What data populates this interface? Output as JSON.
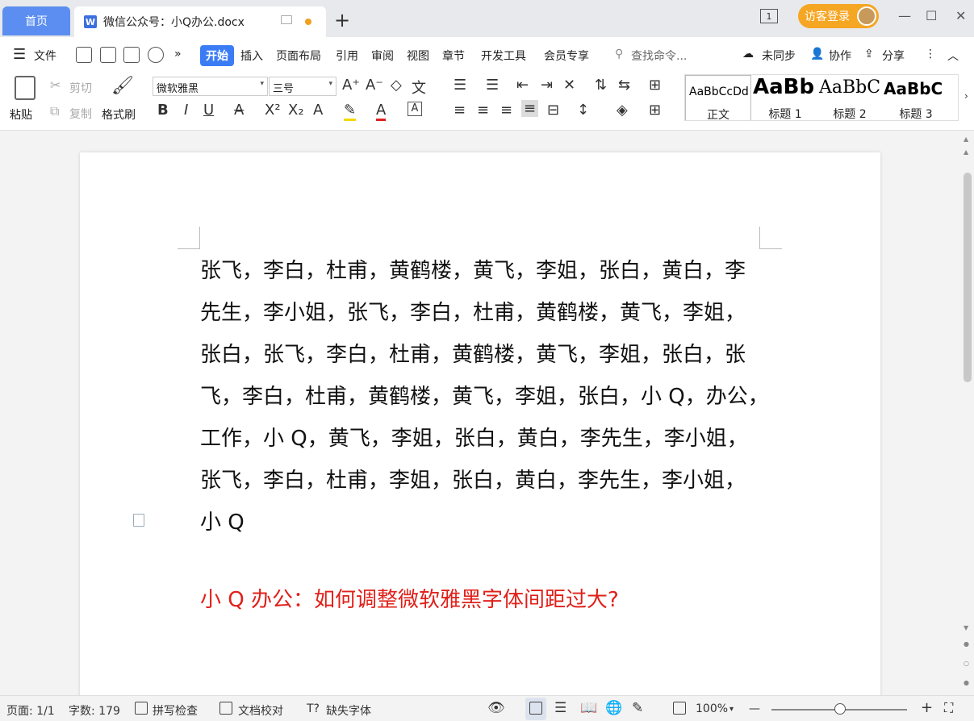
{
  "titlebar": {
    "home_tab": "首页",
    "doc_tab": "微信公众号：小Q办公.docx",
    "doc_icon": "W",
    "new_tab": "+",
    "window_count": "1",
    "guest_login": "访客登录",
    "minimize": "—",
    "maximize": "☐",
    "close": "✕"
  },
  "menubar": {
    "file": "文件",
    "more": "»",
    "tabs": [
      "开始",
      "插入",
      "页面布局",
      "引用",
      "审阅",
      "视图",
      "章节",
      "开发工具",
      "会员专享"
    ],
    "search": "查找命令...",
    "sync": "未同步",
    "collab": "协作",
    "share": "分享",
    "menu": "⋮",
    "collapse": "︿"
  },
  "ribbon": {
    "paste": "粘贴",
    "cut": "剪切",
    "copy": "复制",
    "format_painter": "格式刷",
    "font_name": "微软雅黑",
    "font_size": "三号",
    "styles": [
      {
        "sample": "AaBbCcDd",
        "name": "正文"
      },
      {
        "sample": "AaBb",
        "name": "标题 1"
      },
      {
        "sample": "AaBbC",
        "name": "标题 2"
      },
      {
        "sample": "AaBbC",
        "name": "标题 3"
      }
    ]
  },
  "document": {
    "lines": [
      "张飞，李白，杜甫，黄鹤楼，黄飞，李姐，张白，黄白，李",
      "先生，李小姐，张飞，李白，杜甫，黄鹤楼，黄飞，李姐，",
      "张白，张飞，李白，杜甫，黄鹤楼，黄飞，李姐，张白，张",
      "飞，李白，杜甫，黄鹤楼，黄飞，李姐，张白，小 Q，办公，",
      "工作，小 Q，黄飞，李姐，张白，黄白，李先生，李小姐，",
      "张飞，李白，杜甫，李姐，张白，黄白，李先生，李小姐，",
      "小 Q"
    ],
    "red_line": "小 Q 办公：如何调整微软雅黑字体间距过大?",
    "red_color": "#e0201a"
  },
  "statusbar": {
    "page": "页面: 1/1",
    "word_count": "字数: 179",
    "spell_check": "拼写检查",
    "doc_proof": "文档校对",
    "missing_font": "缺失字体",
    "zoom": "100%",
    "zoom_minus": "—",
    "zoom_plus": "+"
  },
  "colors": {
    "accent": "#3b7cf5",
    "home_tab": "#5b8ef0",
    "guest_btn": "#f5a623"
  }
}
